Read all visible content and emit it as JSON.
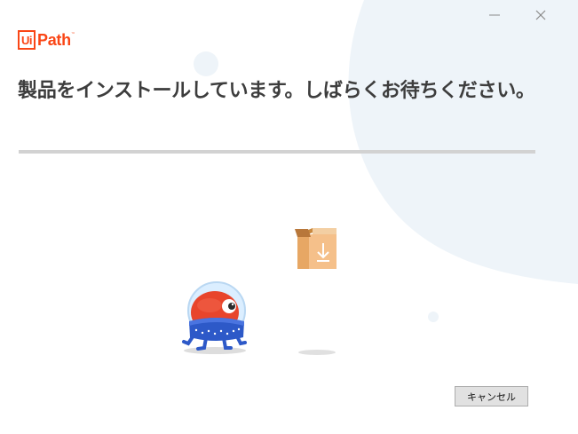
{
  "window": {
    "minimize_glyph": "—",
    "close_glyph": "✕"
  },
  "logo": {
    "mark": "Ui",
    "text": "Path",
    "tm": "™"
  },
  "heading": "製品をインストールしています。しばらくお待ちください。",
  "progress": {
    "value": 0
  },
  "buttons": {
    "cancel": "キャンセル"
  },
  "colors": {
    "brand": "#FA4616",
    "heading": "#3d3d3d",
    "progress_track": "#d2d2d2",
    "decor": "#eef4f9",
    "box": "#F5C08A",
    "robot_body": "#E8452C",
    "robot_base": "#2D59C8"
  },
  "icons": {
    "minimize": "minimize-icon",
    "close": "close-icon",
    "package": "package-download-icon",
    "mascot": "robot-mascot-illustration"
  }
}
